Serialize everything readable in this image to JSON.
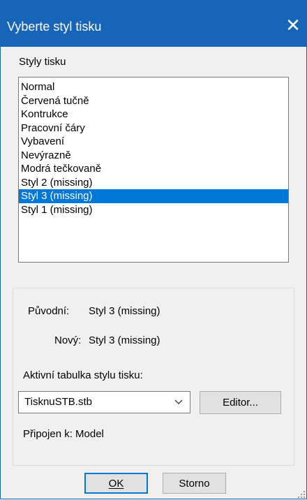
{
  "window": {
    "title": "Vyberte styl tisku",
    "close_glyph": "✕"
  },
  "styles_label": "Styly tisku",
  "styles": [
    "Normal",
    "Červená tučně",
    "Kontrukce",
    "Pracovní čáry",
    "Vybavení",
    "Nevýrazně",
    "Modrá tečkovaně",
    "Styl 2 (missing)",
    "Styl 3 (missing)",
    "Styl 1 (missing)"
  ],
  "selected_style": "Styl 3 (missing)",
  "info": {
    "original_label": "Původní:",
    "original_value": "Styl 3 (missing)",
    "new_label": "Nový:",
    "new_value": "Styl 3 (missing)"
  },
  "table": {
    "label": "Aktivní tabulka stylu tisku:",
    "selected": "TisknuSTB.stb",
    "editor_button": "Editor..."
  },
  "attached": "Připojen k: Model",
  "buttons": {
    "ok": "OK",
    "cancel": "Storno"
  },
  "colors": {
    "titlebar": "#1665b8",
    "selection": "#0078d7"
  }
}
